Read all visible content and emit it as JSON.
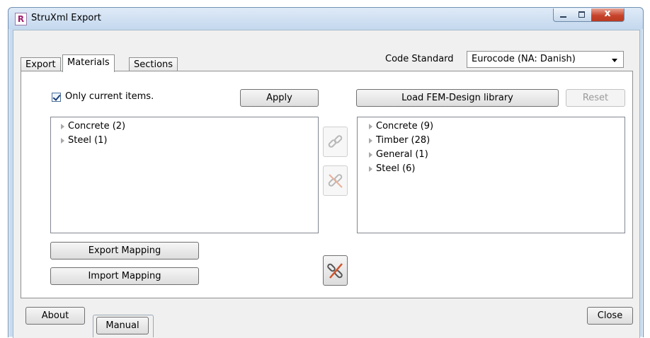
{
  "window": {
    "title": "StruXml Export",
    "app_icon_letter": "R",
    "close_glyph": "x"
  },
  "tabs": [
    {
      "label": "Export",
      "active": false
    },
    {
      "label": "Materials",
      "active": true
    },
    {
      "label": "Sections",
      "active": false
    }
  ],
  "code_standard": {
    "label": "Code Standard",
    "value": "Eurocode (NA: Danish)"
  },
  "materials": {
    "only_current_label": "Only current items.",
    "only_current_checked": true,
    "apply_label": "Apply",
    "load_library_label": "Load FEM-Design library",
    "reset_label": "Reset",
    "left_items": [
      {
        "label": "Concrete  (2)"
      },
      {
        "label": "Steel  (1)"
      }
    ],
    "right_items": [
      {
        "label": "Concrete  (9)"
      },
      {
        "label": "Timber  (28)"
      },
      {
        "label": "General  (1)"
      },
      {
        "label": "Steel  (6)"
      }
    ],
    "link_icon": "link-icon",
    "unlink_icon": "unlink-icon",
    "unlink_all_icon": "unlink-all-icon",
    "export_mapping_label": "Export Mapping",
    "import_mapping_label": "Import Mapping"
  },
  "footer": {
    "about_label": "About",
    "close_label": "Close",
    "manual_label": "Manual"
  },
  "colors": {
    "window_frame": "#c9dcef",
    "close_button": "#c8442c",
    "unlink_accent": "#d2552c"
  }
}
